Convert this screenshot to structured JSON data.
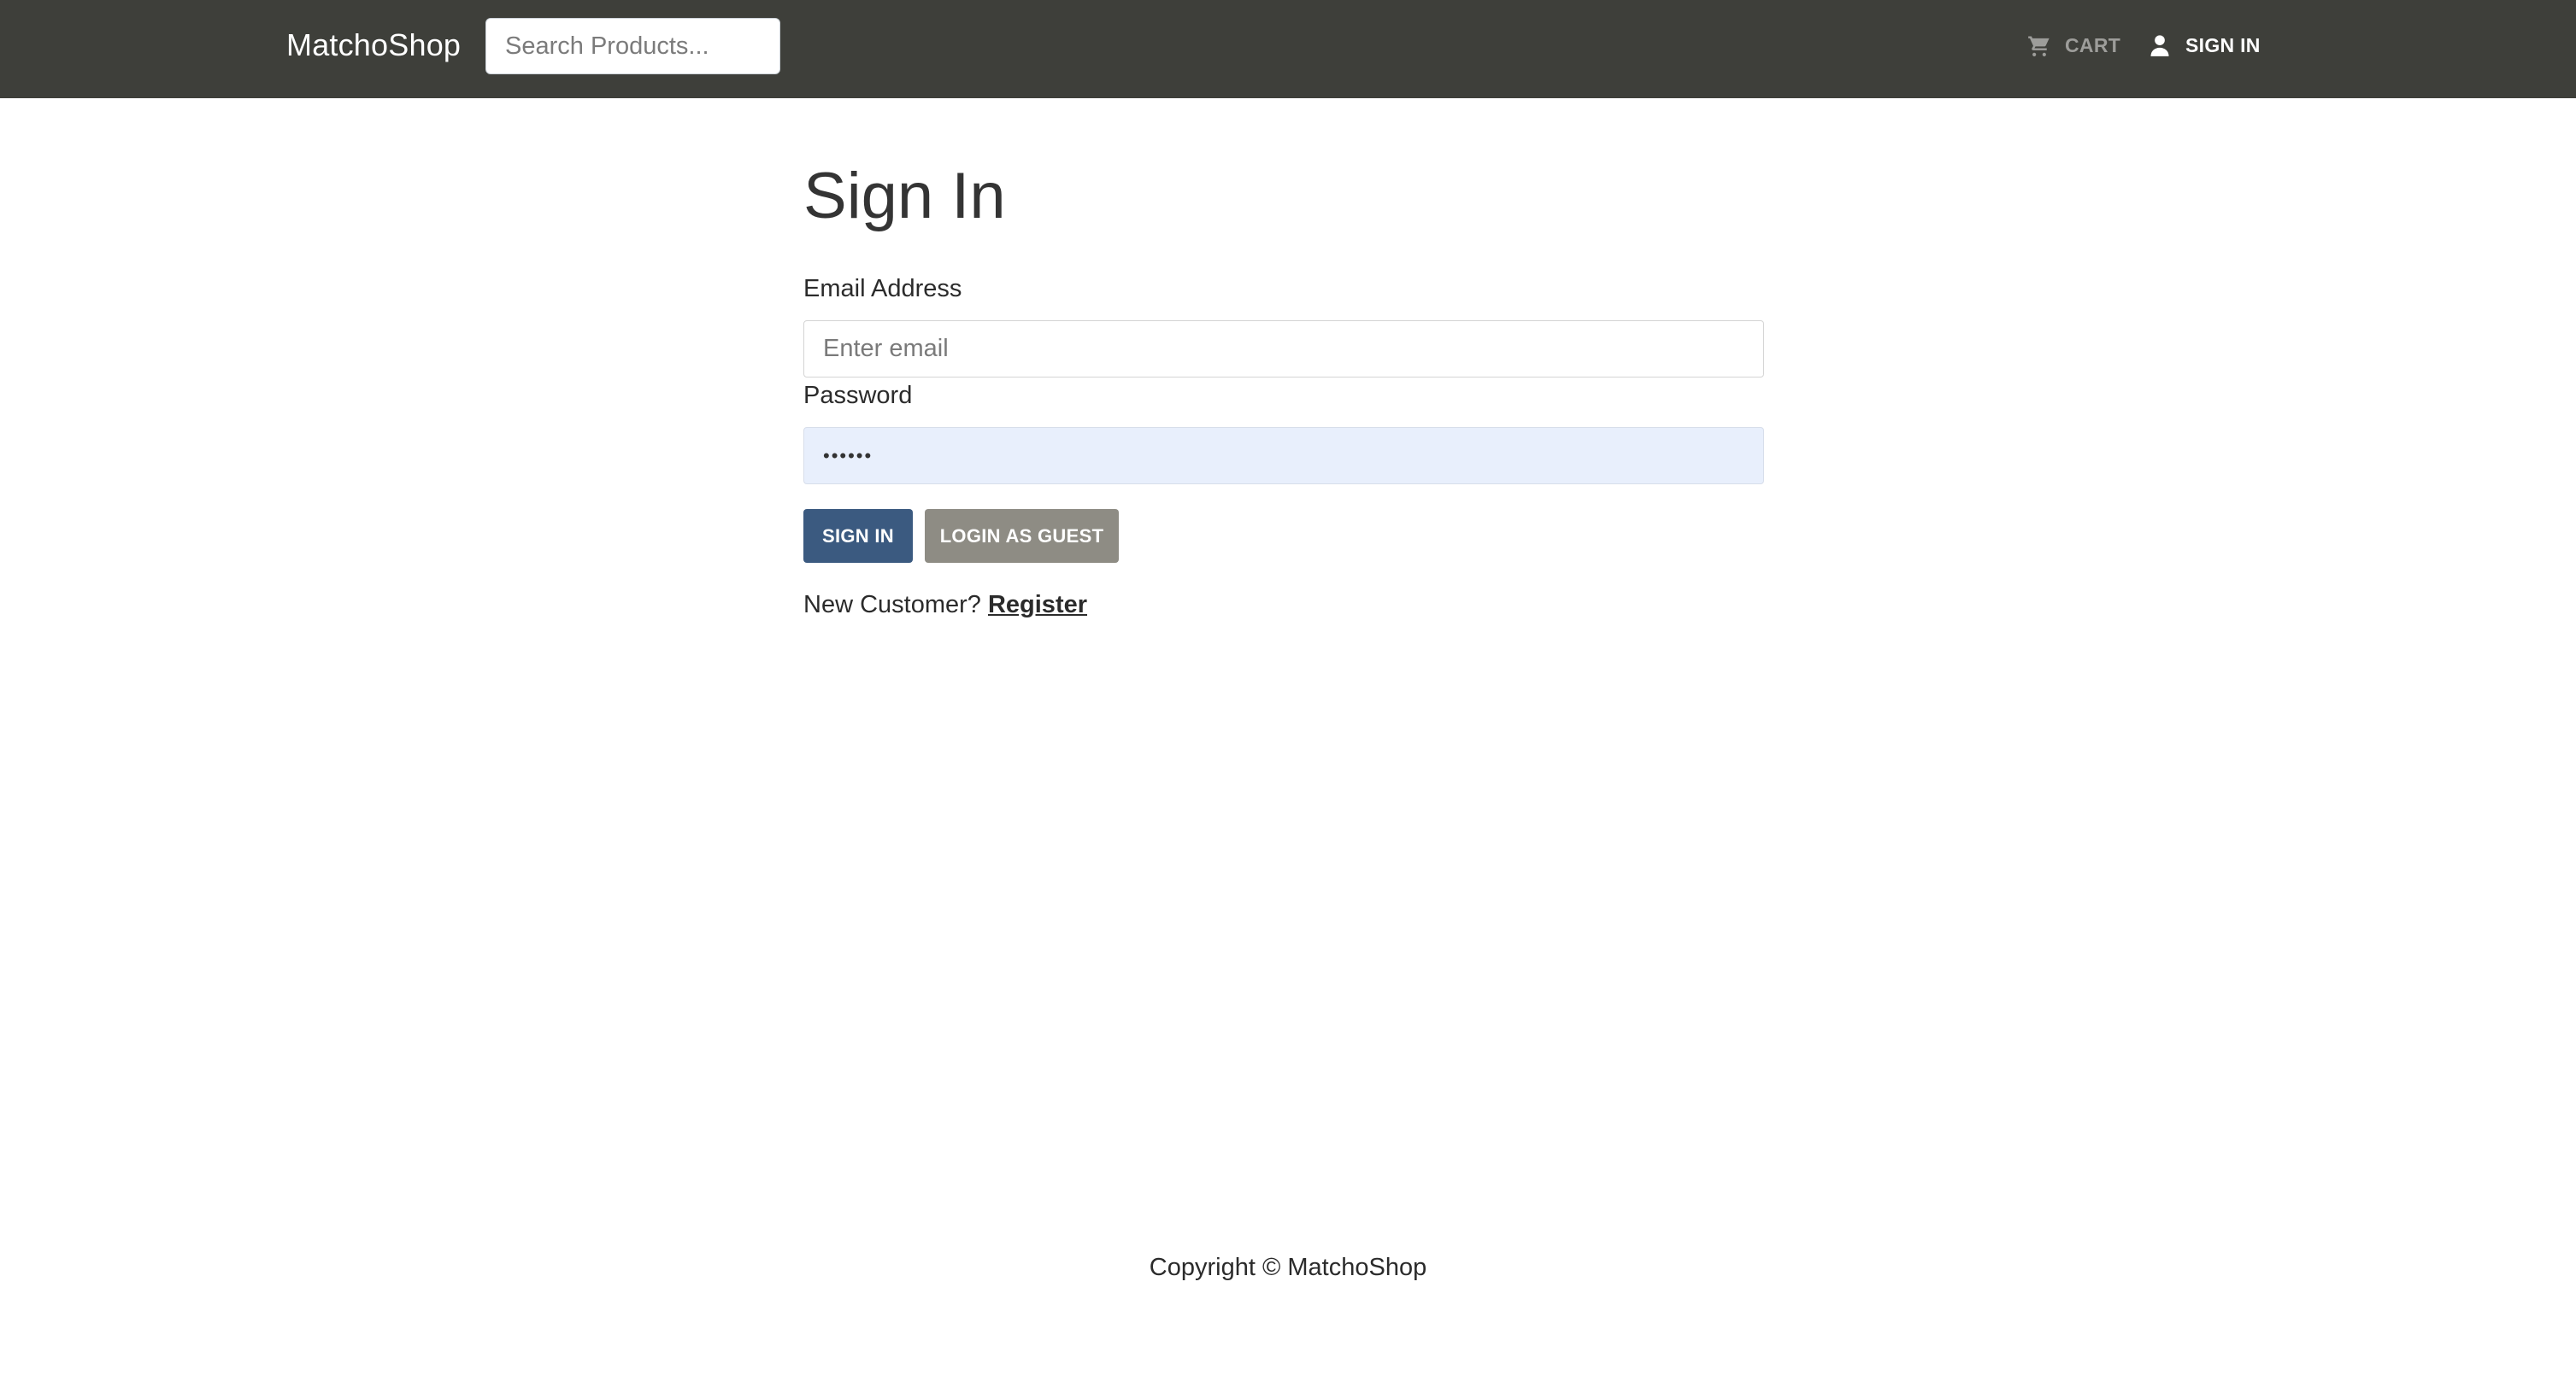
{
  "navbar": {
    "brand": "MatchoShop",
    "search_placeholder": "Search Products...",
    "cart_label": "CART",
    "cart_icon": "cart-icon",
    "signin_label": "SIGN IN",
    "signin_icon": "user-icon"
  },
  "form": {
    "title": "Sign In",
    "email_label": "Email Address",
    "email_placeholder": "Enter email",
    "email_value": "",
    "password_label": "Password",
    "password_value": "••••••",
    "signin_button": "SIGN IN",
    "guest_button": "LOGIN AS GUEST",
    "new_customer_text": "New Customer?",
    "register_link": "Register"
  },
  "footer": {
    "copyright": "Copyright © MatchoShop"
  },
  "colors": {
    "navbar_bg": "#3e3f3a",
    "primary_button": "#3b5a80",
    "secondary_button": "#8e8c84",
    "autofill_bg": "#e8effc"
  }
}
